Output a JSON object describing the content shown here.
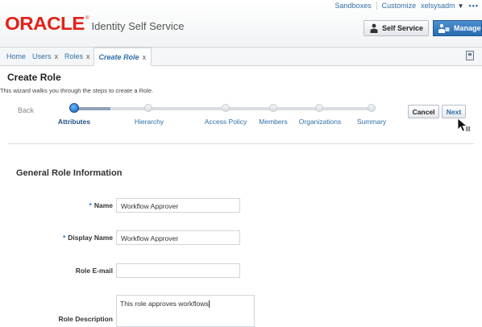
{
  "header": {
    "logo_text": "ORACLE",
    "logo_reg": "®",
    "product": "Identity Self Service",
    "links": {
      "sandboxes": "Sandboxes",
      "customize": "Customize",
      "user": "xelsysadm",
      "more": "•••"
    },
    "self_service_label": "Self Service",
    "manage_label": "Manage"
  },
  "tabs": [
    {
      "label": "Home",
      "closable": false
    },
    {
      "label": "Users",
      "closable": true
    },
    {
      "label": "Roles",
      "closable": true
    },
    {
      "label": "Create Role",
      "closable": true,
      "active": true
    }
  ],
  "tab_close_glyph": "x",
  "page": {
    "title": "Create Role",
    "description": "This wizard walks you through the steps to create a Role."
  },
  "wizard": {
    "back_label": "Back",
    "cancel_label": "Cancel",
    "next_label": "Next",
    "steps": [
      "Attributes",
      "Hierarchy",
      "Access Policy",
      "Members",
      "Organizations",
      "Summary"
    ],
    "current_step": 0
  },
  "form": {
    "section_title": "General Role Information",
    "required_marker": "*",
    "name_label": "Name",
    "name_value": "Workflow Approver",
    "display_name_label": "Display Name",
    "display_name_value": "Workflow Approver",
    "email_label": "Role E-mail",
    "email_value": "",
    "description_label": "Role Description",
    "description_value": "This role approves workflows"
  },
  "colors": {
    "brand_red": "#e2231a",
    "link_blue": "#2f6fa7",
    "manage_blue": "#2a6bb0"
  }
}
